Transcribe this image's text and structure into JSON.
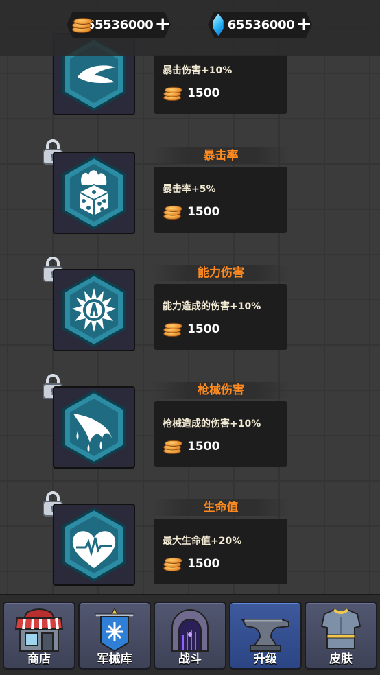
{
  "currency": {
    "coins": {
      "amount": "65536000",
      "add": "+"
    },
    "gems": {
      "amount": "65536000",
      "add": "+"
    }
  },
  "skills": [
    {
      "title": "",
      "description": "暴击伤害+10%",
      "cost": "1500",
      "icon": "crescent-slash-icon",
      "locked": false
    },
    {
      "title": "暴击率",
      "description": "暴击率+5%",
      "cost": "1500",
      "icon": "flaming-dice-icon",
      "locked": true
    },
    {
      "title": "能力伤害",
      "description": "能力造成的伤害+10%",
      "cost": "1500",
      "icon": "burst-emblem-icon",
      "locked": true
    },
    {
      "title": "枪械伤害",
      "description": "枪械造成的伤害+10%",
      "cost": "1500",
      "icon": "dripping-claw-icon",
      "locked": true
    },
    {
      "title": "生命值",
      "description": "最大生命值+20%",
      "cost": "1500",
      "icon": "heart-pulse-icon",
      "locked": true
    }
  ],
  "nav": {
    "items": [
      {
        "label": "商店",
        "icon": "shop-awning-icon",
        "active": false
      },
      {
        "label": "军械库",
        "icon": "armory-banner-icon",
        "active": false
      },
      {
        "label": "战斗",
        "icon": "dungeon-gate-icon",
        "active": false
      },
      {
        "label": "升级",
        "icon": "anvil-icon",
        "active": true
      },
      {
        "label": "皮肤",
        "icon": "armor-vest-icon",
        "active": false
      }
    ]
  },
  "colors": {
    "accent_title": "#ff8a1e",
    "hex_icon_fill": "#1f6c82",
    "nav_active": "#3a539a"
  }
}
